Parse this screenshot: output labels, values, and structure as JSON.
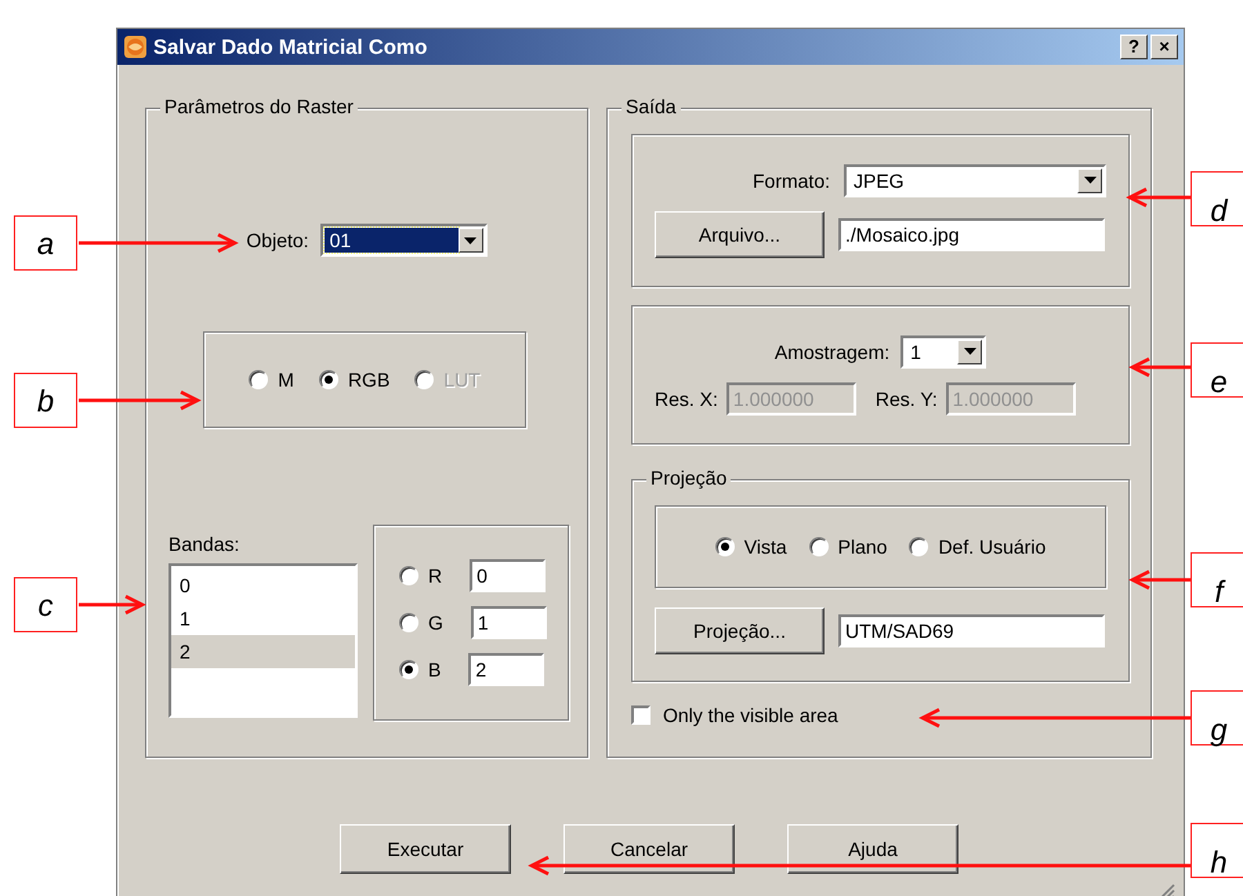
{
  "window": {
    "title": "Salvar Dado Matricial Como",
    "help": "?",
    "close": "×"
  },
  "raster_params": {
    "title": "Parâmetros do Raster",
    "object": {
      "label": "Objeto:",
      "value": "01",
      "focused": true
    },
    "mode": [
      {
        "label": "M",
        "selected": false,
        "disabled": false
      },
      {
        "label": "RGB",
        "selected": true,
        "disabled": false
      },
      {
        "label": "LUT",
        "selected": false,
        "disabled": true
      }
    ],
    "bands": {
      "label": "Bandas:",
      "items": [
        {
          "label": "0",
          "selected": false
        },
        {
          "label": "1",
          "selected": false
        },
        {
          "label": "2",
          "selected": true
        }
      ]
    },
    "channels": [
      {
        "label": "R",
        "selected": false,
        "value": "0"
      },
      {
        "label": "G",
        "selected": false,
        "value": "1"
      },
      {
        "label": "B",
        "selected": true,
        "value": "2"
      }
    ]
  },
  "output": {
    "title": "Saída",
    "format": {
      "label": "Formato:",
      "value": "JPEG"
    },
    "file": {
      "button": "Arquivo...",
      "value": "./Mosaico.jpg"
    },
    "sampling": {
      "label": "Amostragem:",
      "value": "1"
    },
    "res_x": {
      "label": "Res. X:",
      "value": "1.000000",
      "disabled": true
    },
    "res_y": {
      "label": "Res. Y:",
      "value": "1.000000",
      "disabled": true
    },
    "projection": {
      "title": "Projeção",
      "options": [
        {
          "label": "Vista",
          "selected": true
        },
        {
          "label": "Plano",
          "selected": false
        },
        {
          "label": "Def. Usuário",
          "selected": false
        }
      ],
      "button": "Projeção...",
      "value": "UTM/SAD69"
    },
    "visible_area": {
      "label": "Only the visible area",
      "checked": false
    }
  },
  "buttons": [
    "Executar",
    "Cancelar",
    "Ajuda"
  ],
  "callouts": [
    "a",
    "b",
    "c",
    "d",
    "e",
    "f",
    "g",
    "h"
  ]
}
